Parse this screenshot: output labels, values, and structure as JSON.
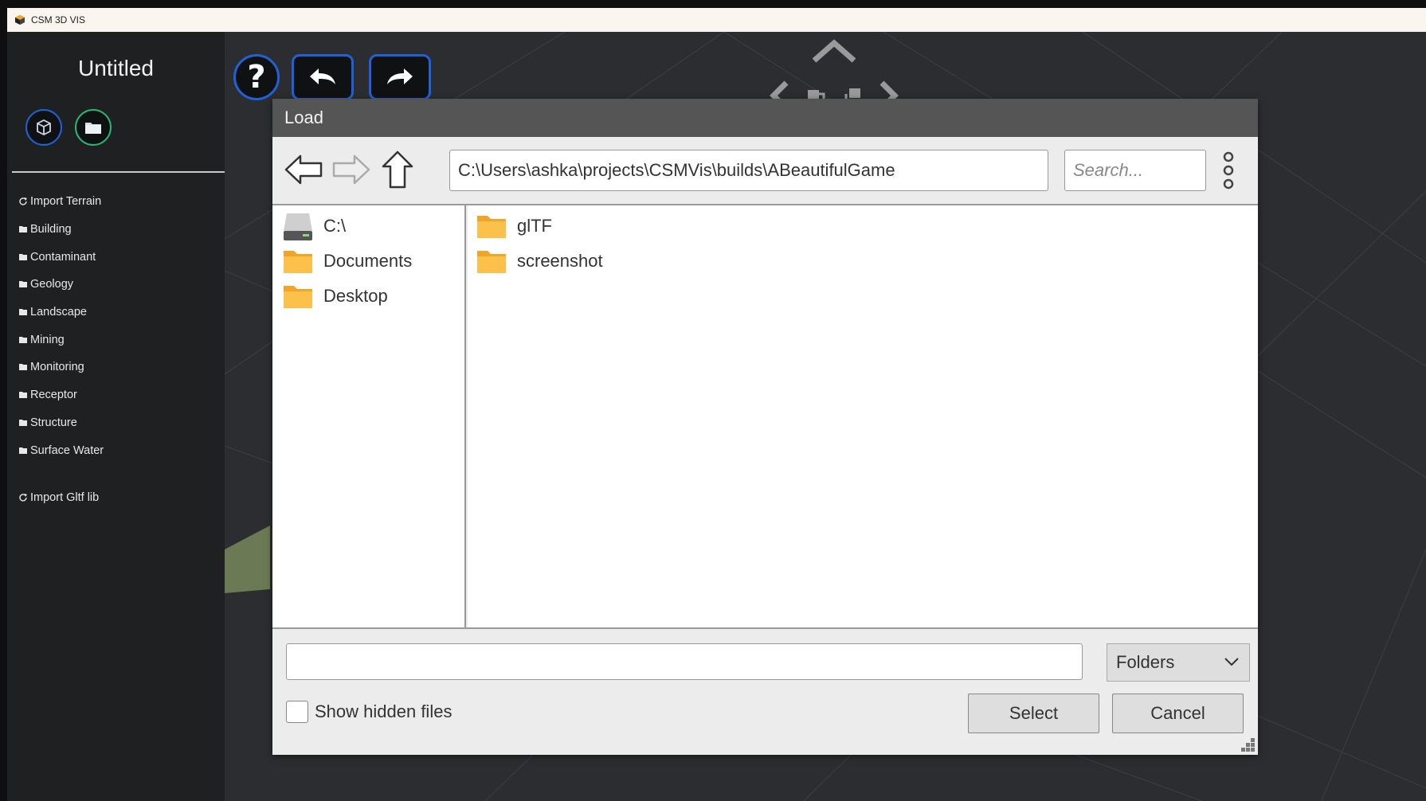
{
  "window": {
    "title": "CSM 3D VIS"
  },
  "sidebar": {
    "project_title": "Untitled",
    "items": [
      {
        "label": "Import Terrain",
        "icon": "refresh-icon"
      },
      {
        "label": "Building",
        "icon": "folder-icon"
      },
      {
        "label": "Contaminant",
        "icon": "folder-icon"
      },
      {
        "label": "Geology",
        "icon": "folder-icon"
      },
      {
        "label": "Landscape",
        "icon": "folder-icon"
      },
      {
        "label": "Mining",
        "icon": "folder-icon"
      },
      {
        "label": "Monitoring",
        "icon": "folder-icon"
      },
      {
        "label": "Receptor",
        "icon": "folder-icon"
      },
      {
        "label": "Structure",
        "icon": "folder-icon"
      },
      {
        "label": "Surface Water",
        "icon": "folder-icon"
      },
      {
        "label": "Import Gltf lib",
        "icon": "refresh-icon"
      }
    ]
  },
  "toolbar": {
    "help_label": "?"
  },
  "dialog": {
    "title": "Load",
    "path": "C:\\Users\\ashka\\projects\\CSMVis\\builds\\ABeautifulGame",
    "search_placeholder": "Search...",
    "quick_access": [
      {
        "label": "C:\\",
        "icon": "drive-icon"
      },
      {
        "label": "Documents",
        "icon": "folder-icon"
      },
      {
        "label": "Desktop",
        "icon": "folder-icon"
      }
    ],
    "files": [
      {
        "label": "glTF",
        "icon": "folder-icon"
      },
      {
        "label": "screenshot",
        "icon": "folder-icon"
      }
    ],
    "filename_value": "",
    "filter_selected": "Folders",
    "show_hidden_label": "Show hidden files",
    "select_label": "Select",
    "cancel_label": "Cancel"
  },
  "colors": {
    "accent_blue": "#1f62d8",
    "accent_green": "#25b87a",
    "folder": "#f7b731"
  }
}
